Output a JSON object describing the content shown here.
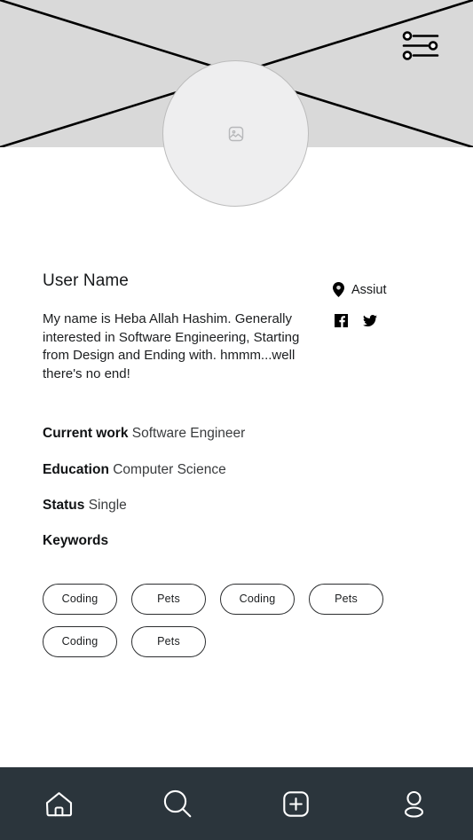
{
  "banner": {
    "background_color": "#d9d9d9",
    "placeholder_cross": true,
    "settings_icon_name": "settings-sliders-icon"
  },
  "avatar": {
    "placeholder_icon_name": "image-placeholder-icon",
    "background_color": "#eeeeef",
    "border_color": "#bcbcbc"
  },
  "profile": {
    "user_name": "User Name",
    "bio": "My name is Heba Allah Hashim. Generally interested in Software Engineering, Starting from Design and Ending with. hmmm...well there's no end!",
    "location": "Assiut",
    "socials": [
      {
        "name": "facebook",
        "icon": "facebook-icon"
      },
      {
        "name": "twitter",
        "icon": "twitter-icon"
      }
    ]
  },
  "info": [
    {
      "label": "Current work",
      "value": "Software Engineer"
    },
    {
      "label": "Education",
      "value": "Computer Science"
    },
    {
      "label": "Status",
      "value": "Single"
    }
  ],
  "keywords": {
    "heading": "Keywords",
    "chips": [
      "Coding",
      "Pets",
      "Coding",
      "Pets",
      "Coding",
      "Pets"
    ]
  },
  "bottom_nav": {
    "background_color": "#2b353c",
    "items": [
      {
        "name": "home",
        "icon": "home-icon"
      },
      {
        "name": "search",
        "icon": "search-icon"
      },
      {
        "name": "add",
        "icon": "plus-square-icon"
      },
      {
        "name": "profile",
        "icon": "person-icon"
      }
    ]
  }
}
